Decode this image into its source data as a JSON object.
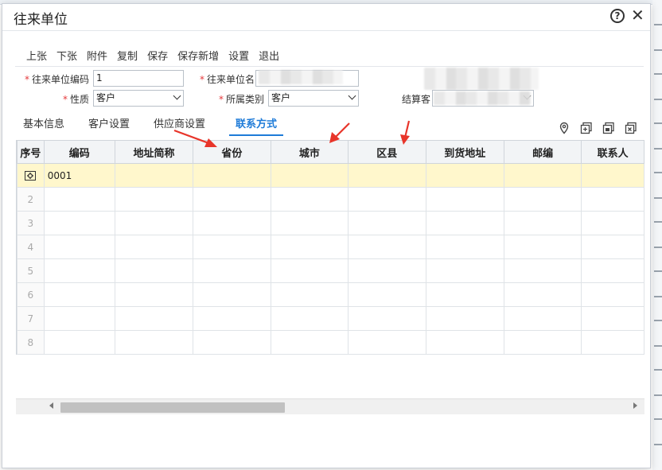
{
  "window": {
    "title": "往来单位"
  },
  "toolbar": {
    "items": [
      "上张",
      "下张",
      "附件",
      "复制",
      "保存",
      "保存新增",
      "设置",
      "退出"
    ]
  },
  "form": {
    "code_label": "往来单位编码",
    "code_value": "1",
    "name_label": "往来单位名",
    "nature_label": "性质",
    "nature_value": "客户",
    "category_label": "所属类别",
    "category_value": "客户",
    "settle_label": "结算客"
  },
  "tabs": [
    "基本信息",
    "客户设置",
    "供应商设置",
    "联系方式"
  ],
  "active_tab_index": 3,
  "tool_icons": [
    "location-icon",
    "add-row-icon",
    "copy-row-icon",
    "delete-row-icon"
  ],
  "grid": {
    "columns": [
      "序号",
      "编码",
      "地址简称",
      "省份",
      "城市",
      "区县",
      "到货地址",
      "邮编",
      "联系人"
    ],
    "rows": [
      {
        "index": "",
        "code": "0001",
        "selected": true
      },
      {
        "index": "2",
        "code": ""
      },
      {
        "index": "3",
        "code": ""
      },
      {
        "index": "4",
        "code": ""
      },
      {
        "index": "5",
        "code": ""
      },
      {
        "index": "6",
        "code": ""
      },
      {
        "index": "7",
        "code": ""
      },
      {
        "index": "8",
        "code": ""
      }
    ]
  },
  "colors": {
    "accent": "#1e7bd8",
    "required": "#e4393c",
    "selected_row": "#fff7cc",
    "arrow": "#e8352a"
  }
}
